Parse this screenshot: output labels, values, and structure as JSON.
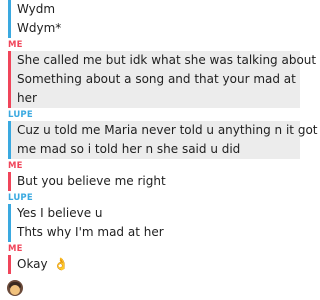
{
  "messages": {
    "top_block": {
      "sender": "",
      "lines": [
        "Wydm",
        "Wdym*"
      ]
    },
    "g1": {
      "sender": "ME",
      "lines": [
        "She called me but idk what she was talking about",
        "Something about a song and that your mad at",
        "her"
      ]
    },
    "g2": {
      "sender": "LUPE",
      "lines": [
        "Cuz u told me Maria never told u anything n it got",
        "me mad so i told her n she said u did"
      ]
    },
    "g3": {
      "sender": "ME",
      "lines": [
        "But you believe me right"
      ]
    },
    "g4": {
      "sender": "LUPE",
      "lines": [
        "Yes I believe u",
        "Thts why I'm mad at her"
      ]
    },
    "g5": {
      "sender": "ME",
      "lines": [
        "Okay"
      ],
      "emoji": "👌"
    }
  },
  "colors": {
    "me_accent": "#f0455a",
    "lupe_accent": "#3aa9e0",
    "highlight_bg": "#ececec"
  },
  "icons": {
    "avatar": "bitmoji-avatar"
  }
}
